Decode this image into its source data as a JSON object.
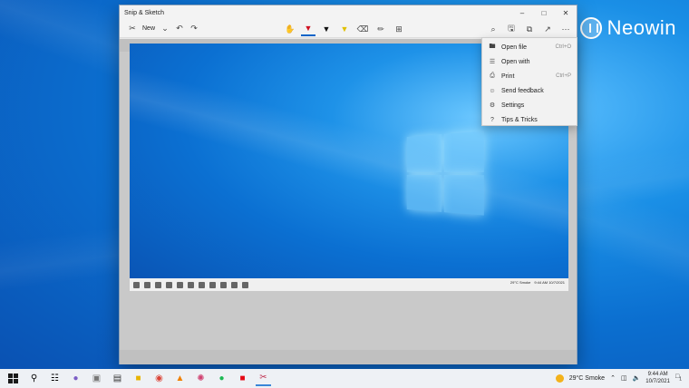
{
  "watermark": {
    "text": "Neowin"
  },
  "window": {
    "title": "Snip & Sketch",
    "toolbar": {
      "new_label": "New"
    }
  },
  "menu": {
    "items": [
      {
        "label": "Open file",
        "shortcut": "Ctrl+O",
        "icon": "folder-icon"
      },
      {
        "label": "Open with",
        "shortcut": "",
        "icon": "open-with-icon"
      },
      {
        "label": "Print",
        "shortcut": "Ctrl+P",
        "icon": "printer-icon"
      },
      {
        "label": "Send feedback",
        "shortcut": "",
        "icon": "feedback-icon"
      },
      {
        "label": "Settings",
        "shortcut": "",
        "icon": "gear-icon"
      },
      {
        "label": "Tips & Tricks",
        "shortcut": "",
        "icon": "question-icon"
      }
    ]
  },
  "snip": {
    "weather": "29°C Smoke",
    "time": "9:44 AM",
    "date": "10/7/2021"
  },
  "taskbar": {
    "weather": "29°C Smoke",
    "time": "9:44 AM",
    "date": "10/7/2021",
    "notification_count": "1"
  },
  "colors": {
    "accent": "#0a64c8",
    "desktop": "#1a8fe6"
  }
}
